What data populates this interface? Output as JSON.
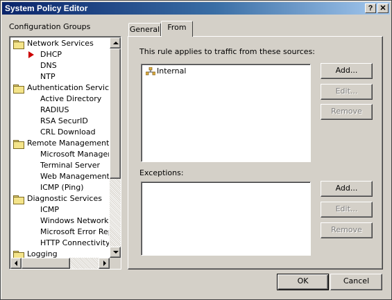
{
  "window": {
    "title": "System Policy Editor",
    "help_label": "?",
    "close_label": "✕"
  },
  "groups": {
    "heading": "Configuration Groups",
    "items": [
      {
        "label": "Network Services",
        "type": "folder"
      },
      {
        "label": "DHCP",
        "type": "child",
        "selected": true
      },
      {
        "label": "DNS",
        "type": "child"
      },
      {
        "label": "NTP",
        "type": "child"
      },
      {
        "label": "Authentication Services",
        "type": "folder"
      },
      {
        "label": "Active Directory",
        "type": "child"
      },
      {
        "label": "RADIUS",
        "type": "child"
      },
      {
        "label": "RSA SecurID",
        "type": "child"
      },
      {
        "label": "CRL Download",
        "type": "child"
      },
      {
        "label": "Remote Management",
        "type": "folder"
      },
      {
        "label": "Microsoft Manageme",
        "type": "child"
      },
      {
        "label": "Terminal Server",
        "type": "child"
      },
      {
        "label": "Web Management",
        "type": "child"
      },
      {
        "label": "ICMP (Ping)",
        "type": "child"
      },
      {
        "label": "Diagnostic Services",
        "type": "folder"
      },
      {
        "label": "ICMP",
        "type": "child"
      },
      {
        "label": "Windows Networking",
        "type": "child"
      },
      {
        "label": "Microsoft Error Repo",
        "type": "child"
      },
      {
        "label": "HTTP Connectivity ve",
        "type": "child"
      },
      {
        "label": "Logging",
        "type": "folder"
      }
    ]
  },
  "tabs": [
    {
      "label": "General",
      "active": false
    },
    {
      "label": "From",
      "active": true
    }
  ],
  "from_tab": {
    "sources_label": "This rule applies to traffic from these sources:",
    "sources": [
      {
        "label": "Internal"
      }
    ],
    "add_label": "Add...",
    "edit_label": "Edit...",
    "remove_label": "Remove",
    "exceptions_label": "Exceptions:",
    "exceptions": [],
    "exc_add_label": "Add...",
    "exc_edit_label": "Edit...",
    "exc_remove_label": "Remove"
  },
  "footer": {
    "ok_label": "OK",
    "cancel_label": "Cancel"
  }
}
